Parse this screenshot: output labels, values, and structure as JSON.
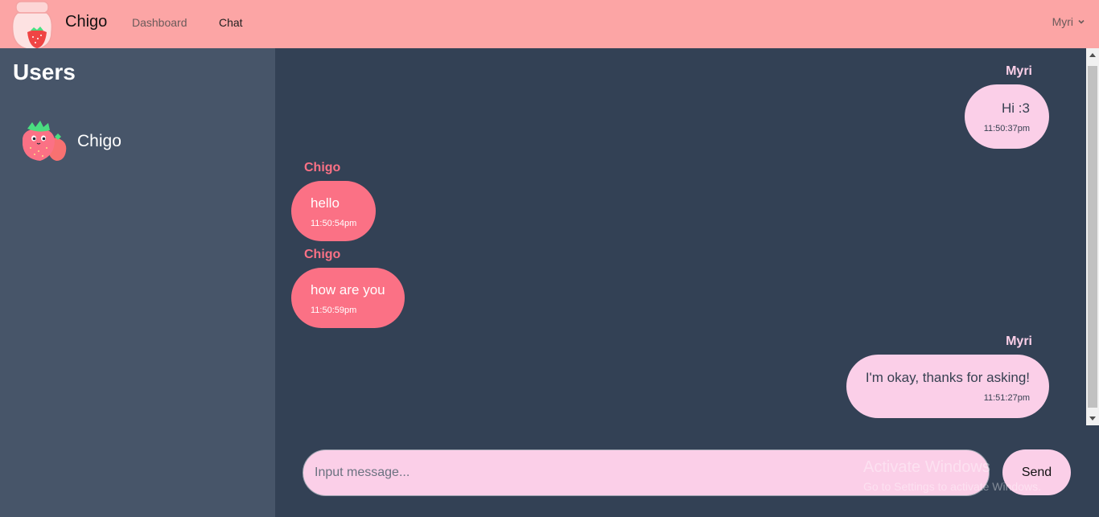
{
  "navbar": {
    "brand": "Chigo",
    "links": [
      "Dashboard",
      "Chat"
    ],
    "user": "Myri",
    "color": "#fca5a5"
  },
  "sidebar": {
    "title": "Users",
    "users": [
      {
        "name": "Chigo"
      }
    ]
  },
  "chat": {
    "messages": [
      {
        "sender": "Myri",
        "text": "Hi :3",
        "time": "11:50:37pm",
        "mine": true
      },
      {
        "sender": "Chigo",
        "text": "hello",
        "time": "11:50:54pm",
        "mine": false
      },
      {
        "sender": "Chigo",
        "text": "how are you",
        "time": "11:50:59pm",
        "mine": false
      },
      {
        "sender": "Myri",
        "text": "I'm okay, thanks for asking!",
        "time": "11:51:27pm",
        "mine": true
      }
    ]
  },
  "composer": {
    "placeholder": "Input message...",
    "send_label": "Send"
  },
  "watermark": {
    "title": "Activate Windows",
    "subtitle": "Go to Settings to activate Windows."
  },
  "colors": {
    "bubble_mine": "#fbcfe8",
    "bubble_theirs": "#fb7185",
    "sidebar": "#475569",
    "chat_bg": "#334155"
  }
}
